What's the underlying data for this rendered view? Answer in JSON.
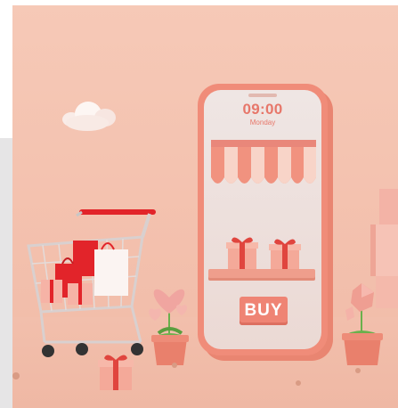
{
  "phone": {
    "time": "09:00",
    "day": "Monday",
    "buy_label": "BUY"
  },
  "colors": {
    "background": "#f4c4b2",
    "phone_body": "#f08c79",
    "screen": "#efe6e4",
    "accent": "#e7776a",
    "cart_red": "#e2242a"
  },
  "icons": [
    "cloud-icon",
    "shopping-cart-icon",
    "gift-box-icon",
    "heart-plant-icon",
    "crystal-plant-icon",
    "awning-icon"
  ]
}
